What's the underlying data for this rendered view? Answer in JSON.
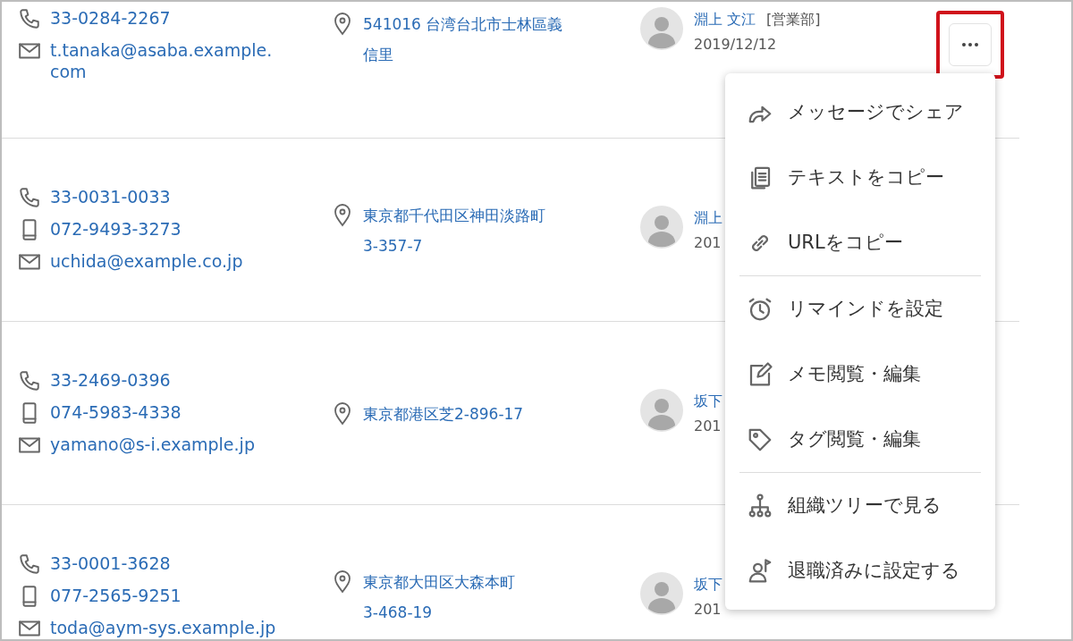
{
  "rows": [
    {
      "contacts": [
        {
          "kind": "phone",
          "text": "33-0284-2267"
        },
        {
          "kind": "email",
          "text": "t.tanaka@asaba.example.com"
        }
      ],
      "address": [
        "541016 台湾台北市士林區義",
        "信里"
      ],
      "person": {
        "name": "淵上 文江",
        "department": "[営業部]",
        "date": "2019/12/12"
      },
      "menu_button": true
    },
    {
      "contacts": [
        {
          "kind": "phone",
          "text": "33-0031-0033"
        },
        {
          "kind": "mobile",
          "text": "072-9493-3273"
        },
        {
          "kind": "email",
          "text": "uchida@example.co.jp"
        }
      ],
      "address": [
        "東京都千代田区神田淡路町",
        "3-357-7"
      ],
      "person": {
        "name": "淵上",
        "date": "201"
      },
      "menu_button": false
    },
    {
      "contacts": [
        {
          "kind": "phone",
          "text": "33-2469-0396"
        },
        {
          "kind": "mobile",
          "text": "074-5983-4338"
        },
        {
          "kind": "email",
          "text": "yamano@s-i.example.jp"
        }
      ],
      "address": [
        "東京都港区芝2-896-17"
      ],
      "person": {
        "name": "坂下",
        "date": "201"
      },
      "menu_button": false
    },
    {
      "contacts": [
        {
          "kind": "phone",
          "text": "33-0001-3628"
        },
        {
          "kind": "mobile",
          "text": "077-2565-9251"
        },
        {
          "kind": "email",
          "text": "toda@aym-sys.example.jp"
        }
      ],
      "address": [
        "東京都大田区大森本町",
        "3-468-19"
      ],
      "person": {
        "name": "坂下",
        "date": "201"
      },
      "menu_button": false
    }
  ],
  "menu": [
    [
      {
        "label": "メッセージでシェア"
      },
      {
        "label": "テキストをコピー"
      },
      {
        "label": "URLをコピー"
      }
    ],
    [
      {
        "label": "リマインドを設定"
      },
      {
        "label": "メモ閲覧・編集"
      },
      {
        "label": "タグ閲覧・編集"
      }
    ],
    [
      {
        "label": "組織ツリーで見る"
      },
      {
        "label": "退職済みに設定する"
      }
    ]
  ]
}
